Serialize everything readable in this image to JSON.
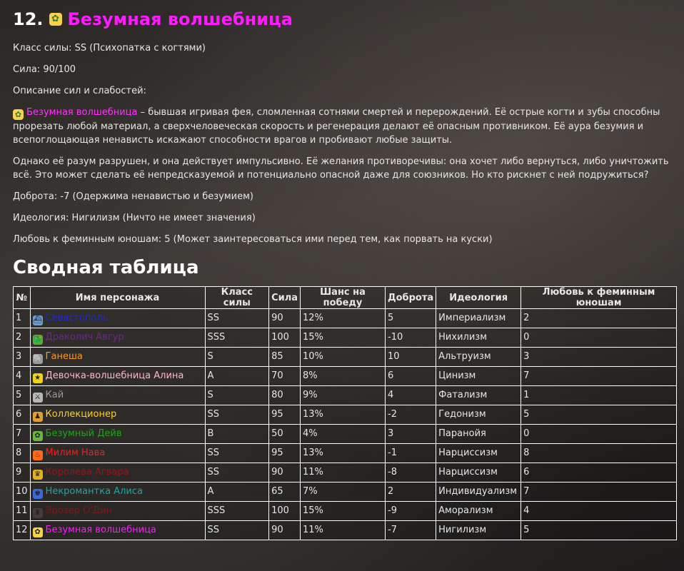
{
  "entry": {
    "number": "12.",
    "icon": "fairy-emoji",
    "title": "Безумная волшебница",
    "title_color": "#ff1aff"
  },
  "lines": {
    "power_class": "Класс силы: SS (Психопатка с когтями)",
    "strength": "Сила: 90/100",
    "desc_heading": "Описание сил и слабостей:",
    "desc_name": "Безумная волшебница",
    "desc_text": " – бывшая игривая фея, сломленная сотнями смертей и перерождений. Её острые когти и зубы способны прорезать любой материал, а сверхчеловеческая скорость и регенерация делают её опасным противником. Её аура безумия и всепоглощающая ненависть искажают способности врагов и пробивают любые защиты.",
    "paragraph2": "Однако её разум разрушен, и она действует импульсивно. Её желания противоречивы: она хочет либо вернуться, либо уничтожить всё. Это может сделать её непредсказуемой и потенциально опасной даже для союзников. Но кто рискнет с ней подружиться?",
    "kindness": "Доброта: -7 (Одержима ненавистью и безумием)",
    "ideology": "Идеология: Нигилизм (Ничто не имеет значения)",
    "love": "Любовь к феминным юношам: 5 (Может заинтересоваться ими перед тем, как порвать на куски)"
  },
  "summary_title": "Сводная таблица",
  "table": {
    "headers": [
      "№",
      "Имя персонажа",
      "Класс силы",
      "Сила",
      "Шанс на победу",
      "Доброта",
      "Идеология",
      "Любовь к феминным юношам"
    ],
    "rows": [
      {
        "n": "1",
        "icon": "ship-icon",
        "icon_bg": "#6aa0d8",
        "name": "Севастополь",
        "color": "#1f2cc8",
        "cls": "SS",
        "str": "90",
        "win": "12%",
        "kind": "5",
        "ideo": "Империализм",
        "love": "2"
      },
      {
        "n": "2",
        "icon": "dragon-icon",
        "icon_bg": "#5aa83a",
        "name": "Драколич Авгур",
        "color": "#6a2a8a",
        "cls": "SSS",
        "str": "100",
        "win": "15%",
        "kind": "-10",
        "ideo": "Нихилизм",
        "love": "0"
      },
      {
        "n": "3",
        "icon": "elephant-icon",
        "icon_bg": "#9a9a9a",
        "name": "Ганеша",
        "color": "#ff9a1a",
        "cls": "S",
        "str": "85",
        "win": "10%",
        "kind": "10",
        "ideo": "Альтруизм",
        "love": "3"
      },
      {
        "n": "4",
        "icon": "star-icon",
        "icon_bg": "#f0d21a",
        "name": "Девочка-волшебница Алина",
        "color": "#ffb6c8",
        "cls": "A",
        "str": "70",
        "win": "8%",
        "kind": "6",
        "ideo": "Цинизм",
        "love": "7"
      },
      {
        "n": "5",
        "icon": "crossed-swords-icon",
        "icon_bg": "#b8b8b8",
        "name": "Кай",
        "color": "#9a9a9a",
        "cls": "S",
        "str": "80",
        "win": "9%",
        "kind": "4",
        "ideo": "Фатализм",
        "love": "1"
      },
      {
        "n": "6",
        "icon": "collector-icon",
        "icon_bg": "#e0a030",
        "name": "Коллекционер",
        "color": "#ffd21a",
        "cls": "SS",
        "str": "95",
        "win": "13%",
        "kind": "-2",
        "ideo": "Гедонизм",
        "love": "5"
      },
      {
        "n": "7",
        "icon": "sprout-icon",
        "icon_bg": "#6ab83a",
        "name": "Безумный Дейв",
        "color": "#1aa81a",
        "cls": "B",
        "str": "50",
        "win": "4%",
        "kind": "3",
        "ideo": "Паранойя",
        "love": "0"
      },
      {
        "n": "8",
        "icon": "fire-icon",
        "icon_bg": "#ff6a1a",
        "name": "Милим Нава",
        "color": "#ff1a1a",
        "cls": "SS",
        "str": "95",
        "win": "13%",
        "kind": "-1",
        "ideo": "Нарциссизм",
        "love": "8"
      },
      {
        "n": "9",
        "icon": "crown-icon",
        "icon_bg": "#e0b020",
        "name": "Королева Агвара",
        "color": "#8a1a1a",
        "cls": "SS",
        "str": "90",
        "win": "11%",
        "kind": "-8",
        "ideo": "Нарциссизм",
        "love": "6"
      },
      {
        "n": "10",
        "icon": "siblings-icon",
        "icon_bg": "#3a6ad8",
        "name": "Некромантка Алиса",
        "color": "#1aa8a8",
        "cls": "A",
        "str": "65",
        "win": "7%",
        "kind": "2",
        "ideo": "Индивидуализм",
        "love": "7"
      },
      {
        "n": "11",
        "icon": "figure-icon",
        "icon_bg": "#4a3a3a",
        "name": "Эрозер О'Дин",
        "color": "#7a1a1a",
        "cls": "SSS",
        "str": "100",
        "win": "15%",
        "kind": "-9",
        "ideo": "Аморализм",
        "love": "4"
      },
      {
        "n": "12",
        "icon": "fairy-icon",
        "icon_bg": "#f6d34d",
        "name": "Безумная волшебница",
        "color": "#ff1aff",
        "cls": "SS",
        "str": "90",
        "win": "11%",
        "kind": "-7",
        "ideo": "Нигилизм",
        "love": "5"
      }
    ]
  }
}
